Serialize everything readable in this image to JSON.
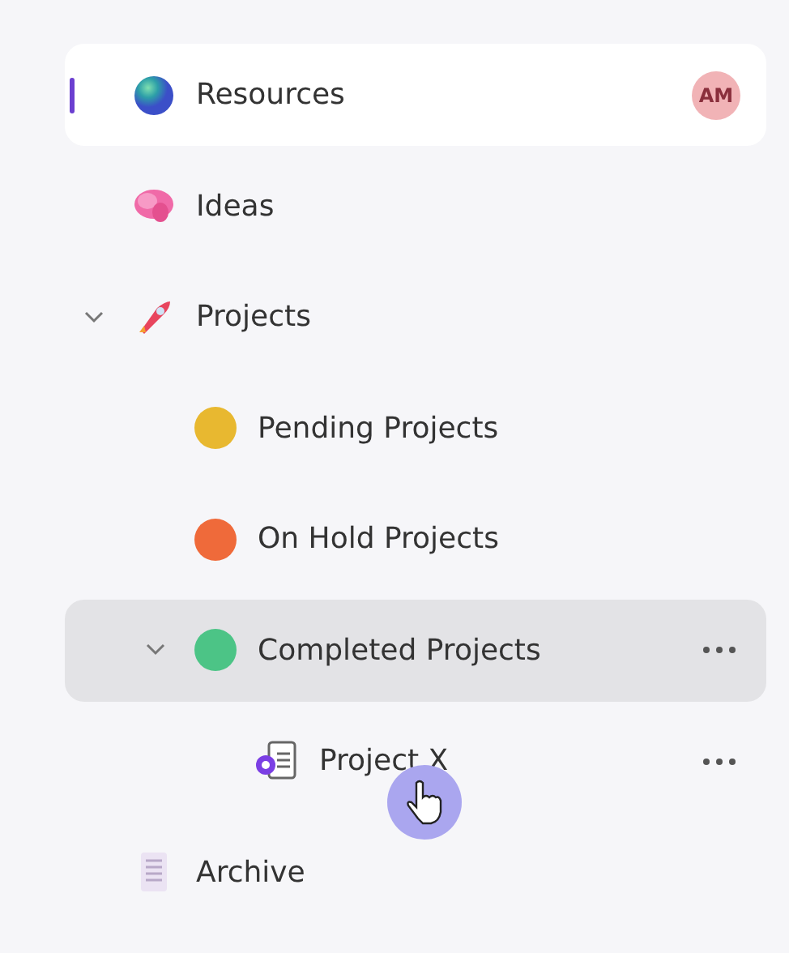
{
  "sidebar": {
    "items": [
      {
        "label": "Resources",
        "kind": "globe",
        "selected": true,
        "hovered": false,
        "badge": "AM",
        "menu": false
      },
      {
        "label": "Ideas",
        "kind": "brain",
        "selected": false,
        "hovered": false,
        "menu": false
      },
      {
        "label": "Projects",
        "kind": "rocket",
        "selected": false,
        "hovered": false,
        "expanded": true,
        "menu": false,
        "children": [
          {
            "label": "Pending Projects",
            "kind": "ball",
            "color": "#e8b830",
            "selected": false,
            "hovered": false,
            "menu": false
          },
          {
            "label": "On Hold Projects",
            "kind": "ball",
            "color": "#ef6a3a",
            "selected": false,
            "hovered": false,
            "menu": false
          },
          {
            "label": "Completed Projects",
            "kind": "ball",
            "color": "#4cc486",
            "selected": false,
            "hovered": true,
            "expanded": true,
            "menu": true,
            "children": [
              {
                "label": "Project X",
                "kind": "doc",
                "selected": false,
                "hovered": false,
                "menu": true
              }
            ]
          }
        ]
      },
      {
        "label": "Archive",
        "kind": "archive",
        "selected": false,
        "hovered": false,
        "menu": false
      }
    ]
  },
  "cursor": {
    "kind": "hand"
  }
}
